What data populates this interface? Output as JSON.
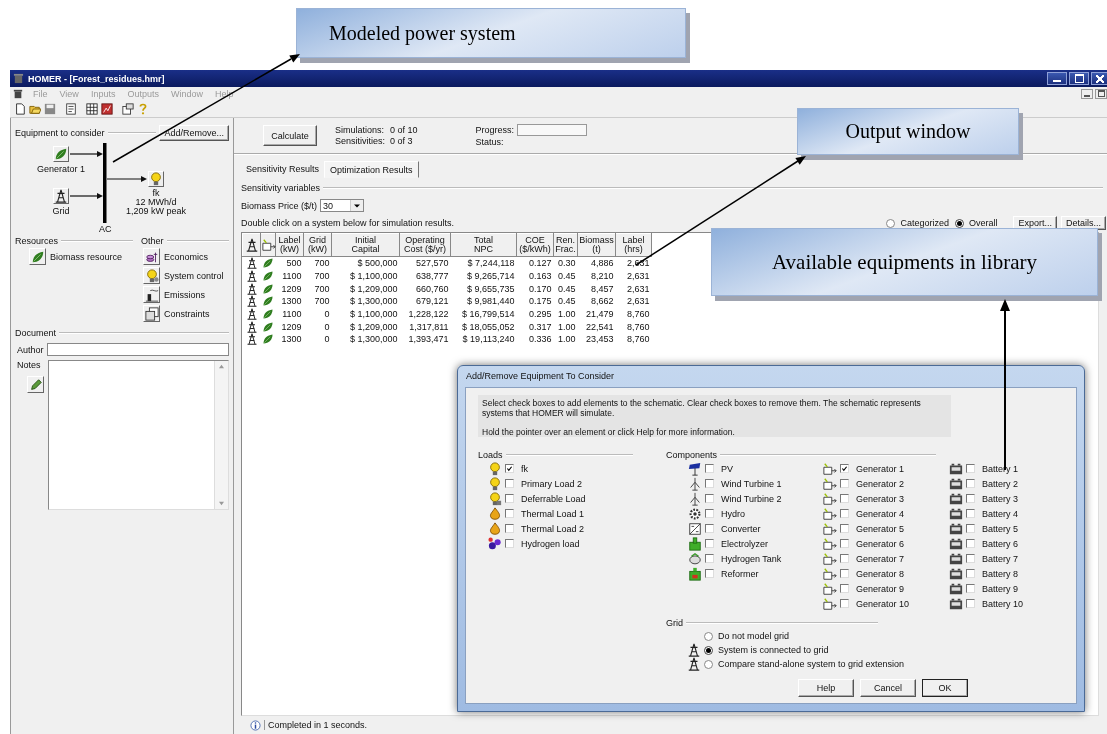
{
  "annotations": [
    {
      "text": "Modeled power system"
    },
    {
      "text": "Output window"
    },
    {
      "text": "Available equipments in library"
    }
  ],
  "window": {
    "title": "HOMER - [Forest_residues.hmr]"
  },
  "menu": [
    {
      "label": "File",
      "disabled": true
    },
    {
      "label": "View",
      "disabled": true
    },
    {
      "label": "Inputs",
      "disabled": true
    },
    {
      "label": "Outputs",
      "disabled": true
    },
    {
      "label": "Window",
      "disabled": true
    },
    {
      "label": "Help",
      "disabled": true
    }
  ],
  "equipment": {
    "title": "Equipment to consider",
    "button": "Add/Remove...",
    "sources": [
      {
        "kind": "leaf",
        "label": "Generator 1"
      },
      {
        "kind": "tower",
        "label": "Grid"
      }
    ],
    "bus": "AC",
    "load": {
      "kind": "bulb",
      "name": "fk",
      "energy": "12 MWh/d",
      "peak": "1,209 kW peak"
    }
  },
  "resources": {
    "title": "Resources",
    "items": [
      {
        "kind": "leaf",
        "label": "Biomass resource"
      }
    ]
  },
  "other": {
    "title": "Other",
    "items": [
      {
        "kind": "economics",
        "label": "Economics"
      },
      {
        "kind": "control",
        "label": "System control"
      },
      {
        "kind": "emissions",
        "label": "Emissions"
      },
      {
        "kind": "constraints",
        "label": "Constraints"
      }
    ]
  },
  "document": {
    "title": "Document",
    "author_label": "Author",
    "notes_label": "Notes"
  },
  "run": {
    "button": "Calculate",
    "simulations_label": "Simulations:",
    "simulations": "0 of 10",
    "sensitivities_label": "Sensitivities:",
    "sensitivities": "0 of 3",
    "progress_label": "Progress:",
    "status_label": "Status:"
  },
  "tabs": [
    {
      "label": "Sensitivity Results",
      "selected": false
    },
    {
      "label": "Optimization Results",
      "selected": true
    }
  ],
  "sensitivity": {
    "title": "Sensitivity variables",
    "label": "Biomass Price ($/t)",
    "value": "30"
  },
  "hint": "Double click on a system below for simulation results.",
  "view_options": [
    {
      "label": "Categorized",
      "selected": false
    },
    {
      "label": "Overall",
      "selected": true
    }
  ],
  "result_buttons": [
    "Export...",
    "Details..."
  ],
  "table": {
    "icon_columns": [
      {
        "kind": "grid"
      },
      {
        "kind": "generator"
      }
    ],
    "columns": [
      "Label\n(kW)",
      "Grid\n(kW)",
      "Initial\nCapital",
      "Operating\nCost ($/yr)",
      "Total\nNPC",
      "COE\n($/kWh)",
      "Ren.\nFrac.",
      "Biomass\n(t)",
      "Label\n(hrs)"
    ],
    "rows": [
      [
        "500",
        "700",
        "$ 500,000",
        "527,570",
        "$ 7,244,118",
        "0.127",
        "0.30",
        "4,886",
        "2,631"
      ],
      [
        "1100",
        "700",
        "$ 1,100,000",
        "638,777",
        "$ 9,265,714",
        "0.163",
        "0.45",
        "8,210",
        "2,631"
      ],
      [
        "1209",
        "700",
        "$ 1,209,000",
        "660,760",
        "$ 9,655,735",
        "0.170",
        "0.45",
        "8,457",
        "2,631"
      ],
      [
        "1300",
        "700",
        "$ 1,300,000",
        "679,121",
        "$ 9,981,440",
        "0.175",
        "0.45",
        "8,662",
        "2,631"
      ],
      [
        "1100",
        "0",
        "$ 1,100,000",
        "1,228,122",
        "$ 16,799,514",
        "0.295",
        "1.00",
        "21,479",
        "8,760"
      ],
      [
        "1209",
        "0",
        "$ 1,209,000",
        "1,317,811",
        "$ 18,055,052",
        "0.317",
        "1.00",
        "22,541",
        "8,760"
      ],
      [
        "1300",
        "0",
        "$ 1,300,000",
        "1,393,471",
        "$ 19,113,240",
        "0.336",
        "1.00",
        "23,453",
        "8,760"
      ]
    ]
  },
  "status": "Completed in 1 seconds.",
  "dialog": {
    "title": "Add/Remove Equipment To Consider",
    "info": [
      "Select check boxes to add elements to the schematic. Clear check boxes to remove them. The schematic represents systems that HOMER will simulate.",
      "Hold the pointer over an element or click Help for more information."
    ],
    "loads": {
      "title": "Loads",
      "items": [
        {
          "kind": "bulb",
          "label": "fk",
          "checked": true
        },
        {
          "kind": "bulb",
          "label": "Primary Load 2",
          "checked": false
        },
        {
          "kind": "deferrable",
          "label": "Deferrable Load",
          "checked": false
        },
        {
          "kind": "thermal",
          "label": "Thermal Load 1",
          "checked": false
        },
        {
          "kind": "thermal",
          "label": "Thermal Load 2",
          "checked": false
        },
        {
          "kind": "hydrogen",
          "label": "Hydrogen load",
          "checked": false
        }
      ]
    },
    "components": {
      "title": "Components",
      "columns": [
        {
          "items": [
            {
              "kind": "pv",
              "label": "PV",
              "checked": false
            },
            {
              "kind": "wind",
              "label": "Wind Turbine 1",
              "checked": false
            },
            {
              "kind": "wind",
              "label": "Wind Turbine 2",
              "checked": false
            },
            {
              "kind": "hydro",
              "label": "Hydro",
              "checked": false
            },
            {
              "kind": "converter",
              "label": "Converter",
              "checked": false
            },
            {
              "kind": "electrolyzer",
              "label": "Electrolyzer",
              "checked": false
            },
            {
              "kind": "tank",
              "label": "Hydrogen Tank",
              "checked": false
            },
            {
              "kind": "reformer",
              "label": "Reformer",
              "checked": false
            }
          ]
        },
        {
          "items": [
            {
              "kind": "generator",
              "label": "Generator 1",
              "checked": true
            },
            {
              "kind": "generator",
              "label": "Generator 2",
              "checked": false
            },
            {
              "kind": "generator",
              "label": "Generator 3",
              "checked": false
            },
            {
              "kind": "generator",
              "label": "Generator 4",
              "checked": false
            },
            {
              "kind": "generator",
              "label": "Generator 5",
              "checked": false
            },
            {
              "kind": "generator",
              "label": "Generator 6",
              "checked": false
            },
            {
              "kind": "generator",
              "label": "Generator 7",
              "checked": false
            },
            {
              "kind": "generator",
              "label": "Generator 8",
              "checked": false
            },
            {
              "kind": "generator",
              "label": "Generator 9",
              "checked": false
            },
            {
              "kind": "generator",
              "label": "Generator 10",
              "checked": false
            }
          ]
        },
        {
          "items": [
            {
              "kind": "battery",
              "label": "Battery 1",
              "checked": false
            },
            {
              "kind": "battery",
              "label": "Battery 2",
              "checked": false
            },
            {
              "kind": "battery",
              "label": "Battery 3",
              "checked": false
            },
            {
              "kind": "battery",
              "label": "Battery 4",
              "checked": false
            },
            {
              "kind": "battery",
              "label": "Battery 5",
              "checked": false
            },
            {
              "kind": "battery",
              "label": "Battery 6",
              "checked": false
            },
            {
              "kind": "battery",
              "label": "Battery 7",
              "checked": false
            },
            {
              "kind": "battery",
              "label": "Battery 8",
              "checked": false
            },
            {
              "kind": "battery",
              "label": "Battery 9",
              "checked": false
            },
            {
              "kind": "battery",
              "label": "Battery 10",
              "checked": false
            }
          ]
        }
      ]
    },
    "grid": {
      "title": "Grid",
      "options": [
        {
          "kind": "plain",
          "label": "Do not model grid",
          "selected": false
        },
        {
          "kind": "tower",
          "label": "System is connected to grid",
          "selected": true
        },
        {
          "kind": "tower",
          "label": "Compare stand-alone system to grid extension",
          "selected": false
        }
      ]
    },
    "buttons": [
      "Help",
      "Cancel",
      "OK"
    ]
  }
}
